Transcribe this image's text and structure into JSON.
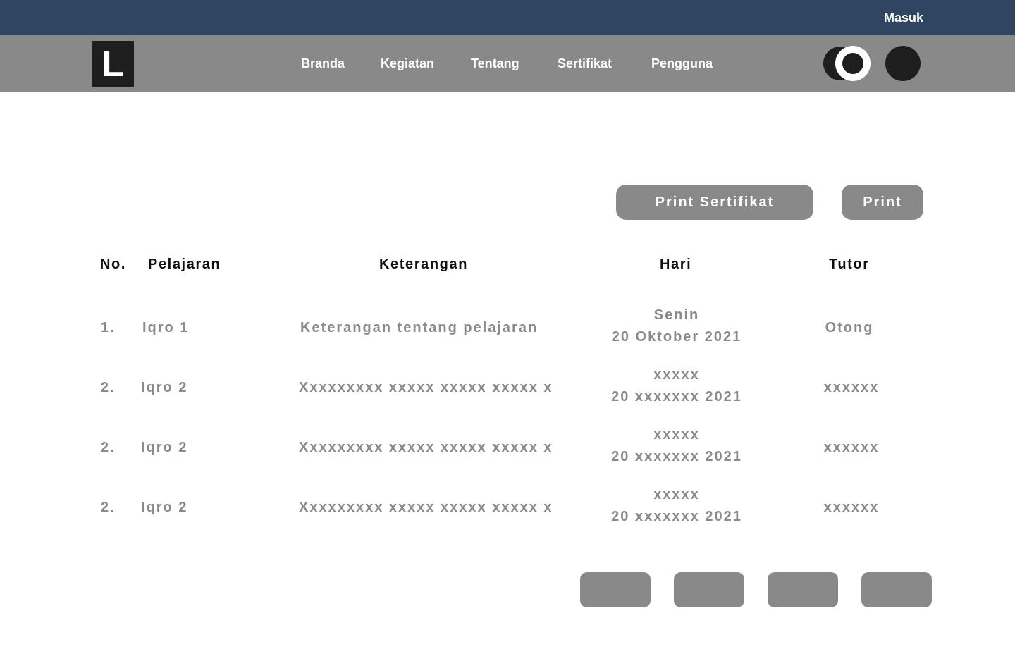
{
  "topbar": {
    "login_label": "Masuk"
  },
  "navbar": {
    "logo_letter": "L",
    "items": [
      "Branda",
      "Kegiatan",
      "Tentang",
      "Sertifikat",
      "Pengguna"
    ]
  },
  "actions": {
    "print_certificate_label": "Print Sertifikat",
    "print_label": "Print"
  },
  "table": {
    "headers": [
      "No.",
      "Pelajaran",
      "Keterangan",
      "Hari",
      "Tutor"
    ],
    "rows": [
      {
        "no": "1.",
        "lesson": "Iqro 1",
        "description": "Keterangan tentang pelajaran",
        "day": "Senin",
        "date": "20 Oktober 2021",
        "tutor": "Otong"
      },
      {
        "no": "2.",
        "lesson": "Iqro 2",
        "description": "Xxxxxxxxx xxxxx xxxxx xxxxx x",
        "day": "xxxxx",
        "date": "20 xxxxxxx 2021",
        "tutor": "xxxxxx"
      },
      {
        "no": "2.",
        "lesson": "Iqro 2",
        "description": "Xxxxxxxxx xxxxx xxxxx xxxxx x",
        "day": "xxxxx",
        "date": "20 xxxxxxx 2021",
        "tutor": "xxxxxx"
      },
      {
        "no": "2.",
        "lesson": "Iqro 2",
        "description": "Xxxxxxxxx xxxxx xxxxx xxxxx x",
        "day": "xxxxx",
        "date": "20 xxxxxxx 2021",
        "tutor": "xxxxxx"
      }
    ]
  },
  "icons": {
    "theme_toggle": "toggle-icon",
    "profile": "avatar-icon"
  },
  "colors": {
    "topbar": "#2f4562",
    "navbar": "#898989",
    "button": "#898989",
    "muted_text": "#8a8a8a"
  }
}
